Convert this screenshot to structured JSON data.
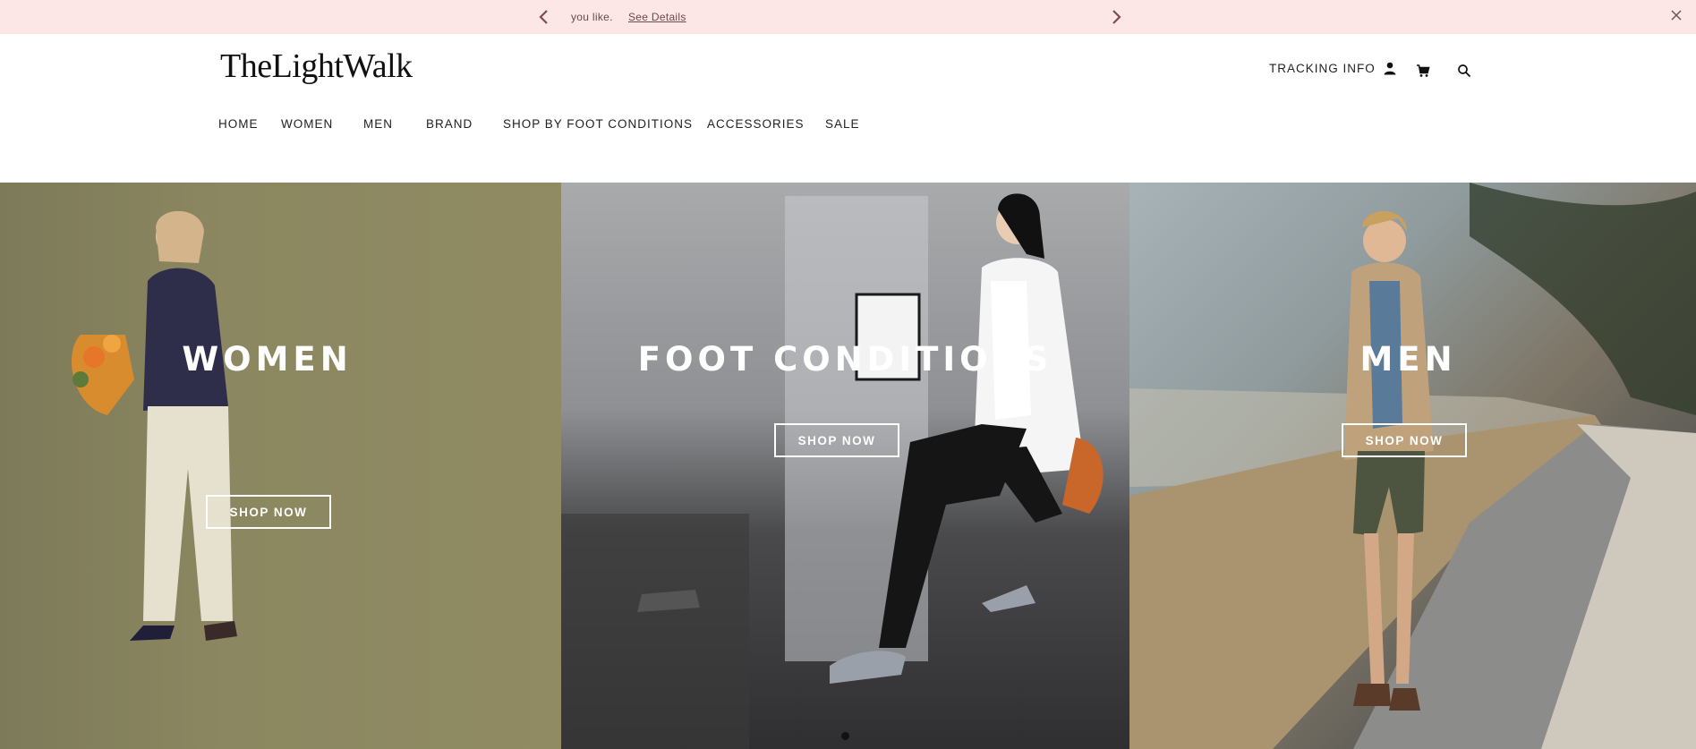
{
  "announcement": {
    "message": "you like.",
    "details_link": "See Details",
    "bg_color": "#fde6e6"
  },
  "header": {
    "logo": "TheLightWalk",
    "tracking_label": "TRACKING INFO",
    "icons": [
      "user-icon",
      "cart-icon",
      "search-icon"
    ]
  },
  "nav": {
    "items": [
      {
        "label": "HOME"
      },
      {
        "label": "WOMEN"
      },
      {
        "label": "MEN"
      },
      {
        "label": "BRAND"
      },
      {
        "label": "SHOP BY FOOT CONDITIONS"
      },
      {
        "label": "ACCESSORIES"
      },
      {
        "label": "SALE"
      }
    ]
  },
  "hero": {
    "panels": [
      {
        "title": "WOMEN",
        "button": "SHOP NOW"
      },
      {
        "title": "FOOT CONDITIONS",
        "button": "SHOP NOW"
      },
      {
        "title": "MEN",
        "button": "SHOP NOW"
      }
    ]
  }
}
